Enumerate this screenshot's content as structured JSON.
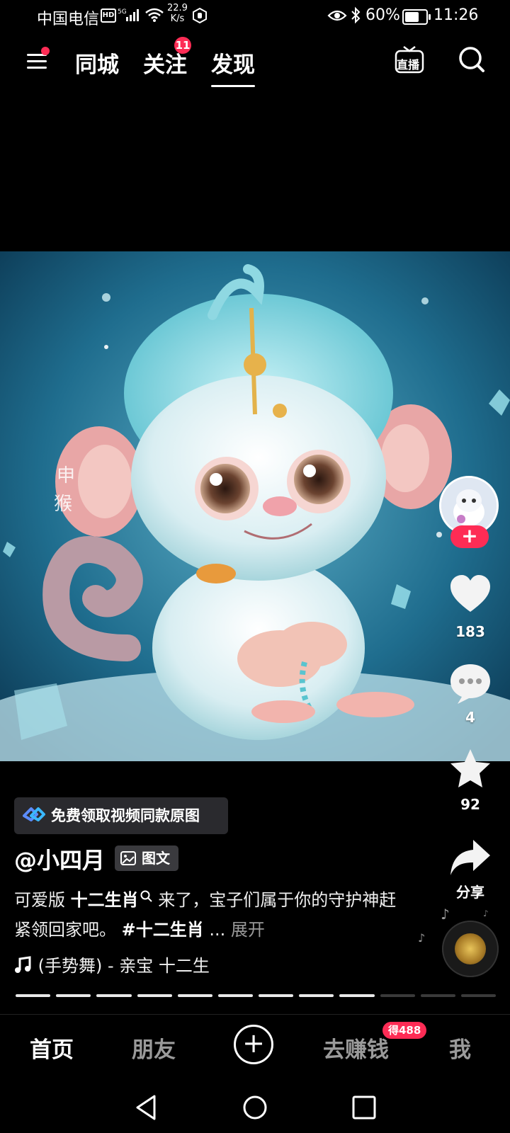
{
  "status_bar": {
    "carrier": "中国电信",
    "hd": "HD",
    "net_speed_value": "22.9",
    "net_speed_unit": "K/s",
    "battery": "60%",
    "time": "11:26"
  },
  "top_nav": {
    "tabs": [
      {
        "label": "同城"
      },
      {
        "label": "关注",
        "badge": "11"
      },
      {
        "label": "发现",
        "active": true
      }
    ],
    "live_label": "直播"
  },
  "post": {
    "image_alt": "cute monkey illustration",
    "watermark": "申猴",
    "likes": "183",
    "comments": "4",
    "favorites": "92",
    "share_label": "分享",
    "promo": "免费领取视频同款原图",
    "author": "@小四月",
    "type_tag": "图文",
    "caption_part1": "可爱版 ",
    "caption_bold1": "十二生肖",
    "caption_part2": " 来了，宝子们属于你的守护神赶紧领回家吧。 ",
    "caption_hashtag": "#十二生肖",
    "caption_ellipsis": " ... ",
    "caption_expand": "展开",
    "music": "(手势舞) - 亲宝    十二生",
    "progress": {
      "total": 12,
      "completed": 9
    }
  },
  "bottom_nav": {
    "home": "首页",
    "friends": "朋友",
    "earn": "去赚钱",
    "earn_badge": "得488",
    "me": "我"
  },
  "colors": {
    "accent": "#fe2c55",
    "background": "#000000"
  }
}
